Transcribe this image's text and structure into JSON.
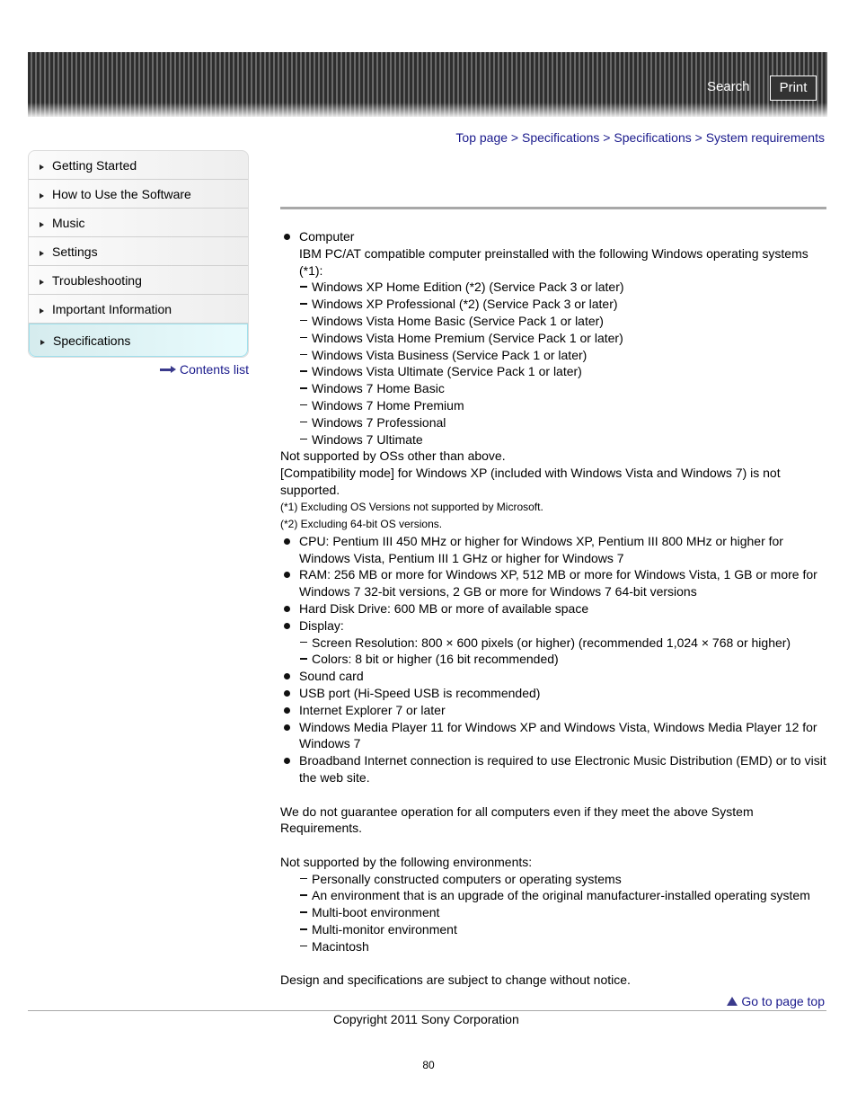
{
  "header": {
    "search_label": "Search",
    "print_label": "Print"
  },
  "breadcrumb": {
    "items": [
      "Top page",
      "Specifications",
      "Specifications",
      "System requirements"
    ],
    "separator": ">"
  },
  "sidebar": {
    "items": [
      {
        "label": "Getting Started",
        "active": false
      },
      {
        "label": "How to Use the Software",
        "active": false
      },
      {
        "label": "Music",
        "active": false
      },
      {
        "label": "Settings",
        "active": false
      },
      {
        "label": "Troubleshooting",
        "active": false
      },
      {
        "label": "Important Information",
        "active": false
      },
      {
        "label": "Specifications",
        "active": true
      }
    ],
    "contents_list_label": "Contents list"
  },
  "content": {
    "computer": {
      "title": "Computer",
      "intro": "IBM PC/AT compatible computer preinstalled with the following Windows operating systems (*1):",
      "os_list": [
        "Windows XP Home Edition (*2) (Service Pack 3 or later)",
        "Windows XP Professional (*2) (Service Pack 3 or later)",
        "Windows Vista Home Basic (Service Pack 1 or later)",
        "Windows Vista Home Premium (Service Pack 1 or later)",
        "Windows Vista Business (Service Pack 1 or later)",
        "Windows Vista Ultimate (Service Pack 1 or later)",
        "Windows 7 Home Basic",
        "Windows 7 Home Premium",
        "Windows 7 Professional",
        "Windows 7 Ultimate"
      ],
      "not_supported": "Not supported by OSs other than above.",
      "compat_mode": "[Compatibility mode] for Windows XP (included with Windows Vista and Windows 7) is not supported.",
      "notes": [
        "(*1) Excluding OS Versions not supported by Microsoft.",
        "(*2) Excluding 64-bit OS versions."
      ]
    },
    "requirements": [
      "CPU: Pentium III 450 MHz or higher for Windows XP, Pentium III 800 MHz or higher for Windows Vista, Pentium III 1 GHz or higher for Windows 7",
      "RAM: 256 MB or more for Windows XP, 512 MB or more for Windows Vista, 1 GB or more for Windows 7 32-bit versions, 2 GB or more for Windows 7 64-bit versions",
      "Hard Disk Drive: 600 MB or more of available space"
    ],
    "display": {
      "title": "Display:",
      "items": [
        "Screen Resolution: 800 × 600 pixels (or higher) (recommended 1,024 × 768 or higher)",
        "Colors: 8 bit or higher (16 bit recommended)"
      ]
    },
    "requirements_more": [
      "Sound card",
      "USB port (Hi-Speed USB is recommended)",
      "Internet Explorer 7 or later",
      "Windows Media Player 11 for Windows XP and Windows Vista, Windows Media Player 12 for Windows 7",
      "Broadband Internet connection is required to use Electronic Music Distribution (EMD) or to visit the web site."
    ],
    "guarantee": "We do not guarantee operation for all computers even if they meet the above System Requirements.",
    "environments_title": "Not supported by the following environments:",
    "environments": [
      "Personally constructed computers or operating systems",
      "An environment that is an upgrade of the original manufacturer-installed operating system",
      "Multi-boot environment",
      "Multi-monitor environment",
      "Macintosh"
    ],
    "change_notice": "Design and specifications are subject to change without notice."
  },
  "footer": {
    "go_to_top": "Go to page top",
    "copyright": "Copyright 2011 Sony Corporation",
    "page_number": "80"
  },
  "colors": {
    "link": "#1a1a8c",
    "active_nav_bg": "#e0f6f8",
    "active_nav_border": "#9fe0ec",
    "rule": "#a8a8a8"
  }
}
